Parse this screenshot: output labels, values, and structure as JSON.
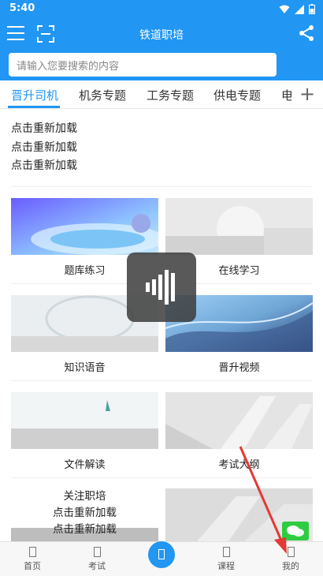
{
  "status_bar": {
    "time": "5:40"
  },
  "app_bar": {
    "title": "铁道职培"
  },
  "search": {
    "placeholder": "请输入您要搜索的内容"
  },
  "tabs": [
    {
      "label": "晋升司机",
      "active": true
    },
    {
      "label": "机务专题"
    },
    {
      "label": "工务专题"
    },
    {
      "label": "供电专题"
    },
    {
      "label": "电"
    }
  ],
  "reload_messages": [
    "点击重新加载",
    "点击重新加载",
    "点击重新加载"
  ],
  "cards": [
    {
      "label": "题库练习"
    },
    {
      "label": "在线学习"
    },
    {
      "label": "知识语音"
    },
    {
      "label": "晋升视频"
    },
    {
      "label": "文件解读"
    },
    {
      "label": "考试大纲"
    }
  ],
  "bottom_card": {
    "title": "关注职培",
    "lines": [
      "点击重新加载",
      "点击重新加载"
    ]
  },
  "bottom_nav": [
    {
      "label": "首页"
    },
    {
      "label": "考试"
    },
    {
      "label": ""
    },
    {
      "label": "课程"
    },
    {
      "label": "我的"
    }
  ],
  "colors": {
    "primary": "#2196f3",
    "annotation_arrow": "#e53935",
    "wechat_green": "#2ecc40"
  }
}
